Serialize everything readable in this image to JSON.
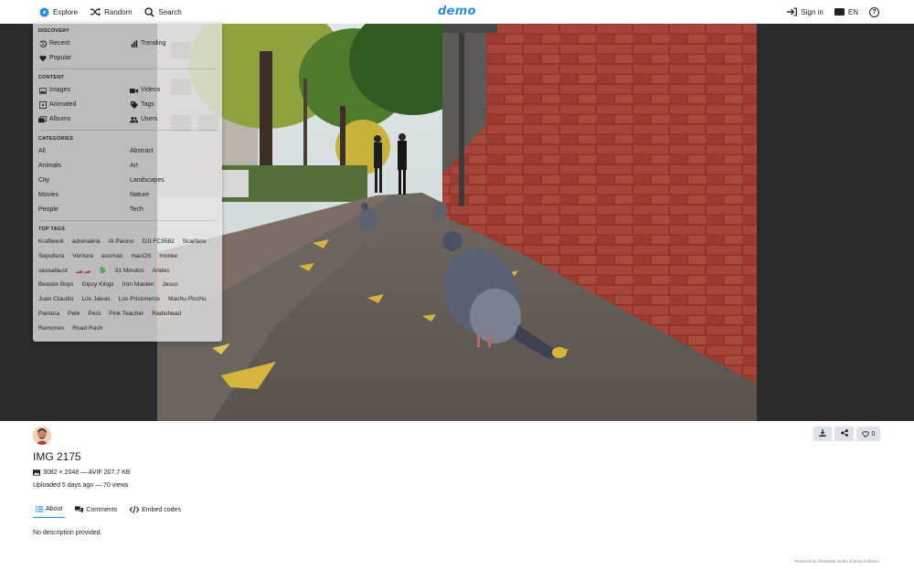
{
  "topbar": {
    "explore": "Explore",
    "random": "Random",
    "search": "Search",
    "logo": "demo",
    "signin": "Sign in",
    "lang_badge": "",
    "lang": "EN",
    "help": "?"
  },
  "menu": {
    "discovery_head": "DISCOVERY",
    "recent": "Recent",
    "trending": "Trending",
    "popular": "Popular",
    "content_head": "CONTENT",
    "images": "Images",
    "videos": "Videos",
    "animated": "Animated",
    "tags": "Tags",
    "albums": "Albums",
    "users": "Users",
    "categories_head": "CATEGORIES",
    "categories": [
      "All",
      "Abstract",
      "Animals",
      "Art",
      "City",
      "Landscapes",
      "Movies",
      "Nature",
      "People",
      "Tech"
    ],
    "toptags_head": "TOP TAGS",
    "tags_list": [
      "Kraftwerk",
      "adrenalina",
      "Al Pacino",
      "DJI FC3582",
      "Scarface",
      "Sepultura",
      "Ventura",
      "asomao",
      "macOS",
      "monke",
      "vaseafaust",
      "🏎️🏎️",
      "🐉",
      "31 Minutos",
      "Andes",
      "Beastie Boys",
      "Gipsy Kings",
      "Iron Maiden",
      "Jesus",
      "Juan Claudio",
      "Los Jaivas",
      "Los Prisioneros",
      "Machu Picchu",
      "Pantera",
      "Pelé",
      "Perú",
      "Pink Teacher",
      "Radiohead",
      "Ramones",
      "Road Rash"
    ]
  },
  "image": {
    "title": "IMG 2175",
    "meta": "3082 × 2048 — AVIF 207.7 KB",
    "uploaded": "Uploaded 5 days ago — 70 views",
    "likes": "0"
  },
  "tabs": [
    "About",
    "Comments",
    "Embed codes"
  ],
  "description": "No description provided.",
  "footer": {
    "powered": "Powered by",
    "brand": "chevereto",
    "rest": "media sharing software"
  },
  "colors": {
    "accent": "#2f8fd8",
    "stage": "#2b2b2b",
    "brick": "#9a3a2c"
  }
}
